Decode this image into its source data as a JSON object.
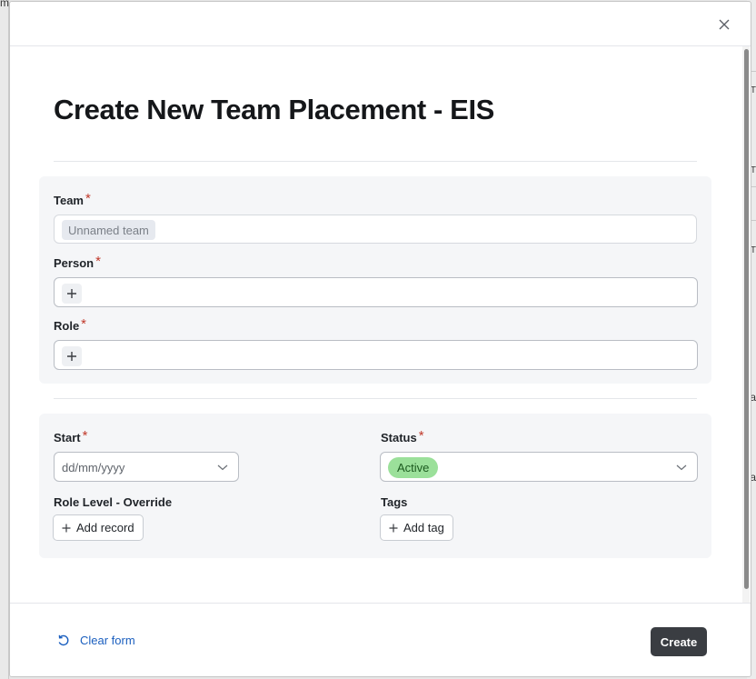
{
  "modal": {
    "title": "Create New Team Placement - EIS",
    "close_icon": "close-icon"
  },
  "team": {
    "label": "Team",
    "required_mark": "*",
    "value": "Unnamed team"
  },
  "person": {
    "label": "Person",
    "required_mark": "*",
    "add_icon": "plus-icon"
  },
  "role": {
    "label": "Role",
    "required_mark": "*",
    "add_icon": "plus-icon"
  },
  "start": {
    "label": "Start",
    "required_mark": "*",
    "placeholder": "dd/mm/yyyy"
  },
  "status": {
    "label": "Status",
    "required_mark": "*",
    "value": "Active",
    "value_color": "#9be09a"
  },
  "role_level": {
    "label": "Role Level - Override",
    "button_label": "Add record"
  },
  "tags": {
    "label": "Tags",
    "button_label": "Add tag"
  },
  "footer": {
    "clear_label": "Clear form",
    "create_label": "Create",
    "create_color": "#3a3d42",
    "link_color": "#1b5fbf"
  },
  "background": {
    "fragments": [
      "m",
      "T",
      "T",
      "T",
      "a",
      "a"
    ]
  }
}
